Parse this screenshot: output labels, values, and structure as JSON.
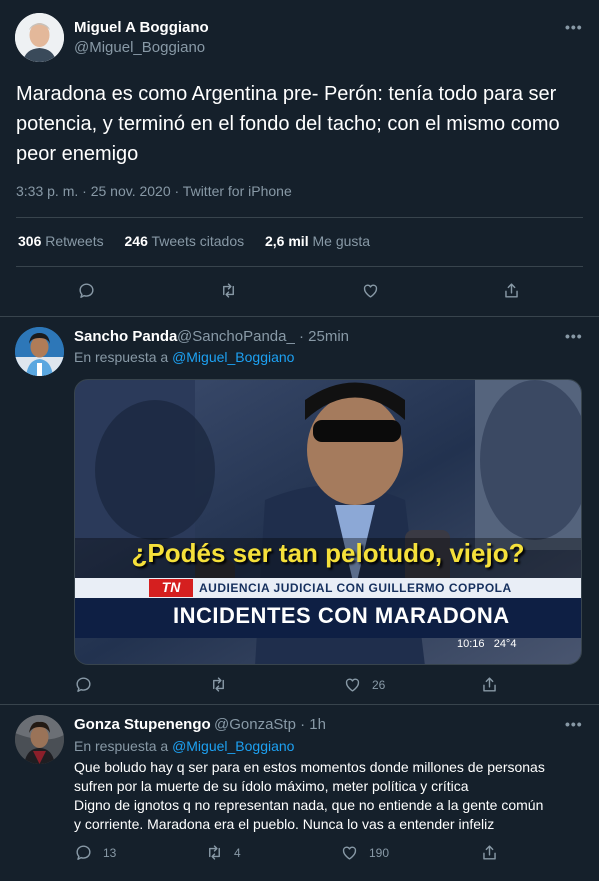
{
  "main_tweet": {
    "name": "Miguel A Boggiano",
    "handle": "@Miguel_Boggiano",
    "text": "Maradona es como Argentina pre- Perón: tenía todo para ser potencia, y terminó en el fondo del tacho; con el mismo como peor enemigo",
    "time": "3:33 p. m. · 25 nov. 2020 · Twitter for iPhone",
    "stats": {
      "retweets_num": "306",
      "retweets_label": "Retweets",
      "quotes_num": "246",
      "quotes_label": "Tweets citados",
      "likes_num": "2,6 mil",
      "likes_label": "Me gusta"
    }
  },
  "replies": [
    {
      "name": "Sancho Panda",
      "handle": "@SanchoPanda_",
      "time": "· 25min",
      "reply_to_prefix": "En respuesta a",
      "reply_to_handle": "@Miguel_Boggiano",
      "media": {
        "subtitle": "¿Podés ser tan pelotudo, viejo?",
        "channel": "TN",
        "ticker": "AUDIENCIA JUDICIAL CON GUILLERMO COPPOLA",
        "headline": "INCIDENTES CON MARADONA",
        "clock": "10:16   24°4"
      },
      "likes": "26"
    },
    {
      "name": "Gonza Stupenengo",
      "handle": "@GonzaStp",
      "time": "· 1h",
      "reply_to_prefix": "En respuesta a",
      "reply_to_handle": "@Miguel_Boggiano",
      "text_lines": [
        "Que boludo hay q ser para en estos momentos donde millones de personas",
        "sufren por la muerte de su ídolo máximo, meter política y crítica",
        "Digno de ignotos q no representan nada, que no entiende a la gente común",
        "y corriente. Maradona era el pueblo. Nunca lo vas a entender infeliz"
      ],
      "replies_count": "13",
      "retweets": "4",
      "likes": "190"
    }
  ],
  "more_label": "•••"
}
